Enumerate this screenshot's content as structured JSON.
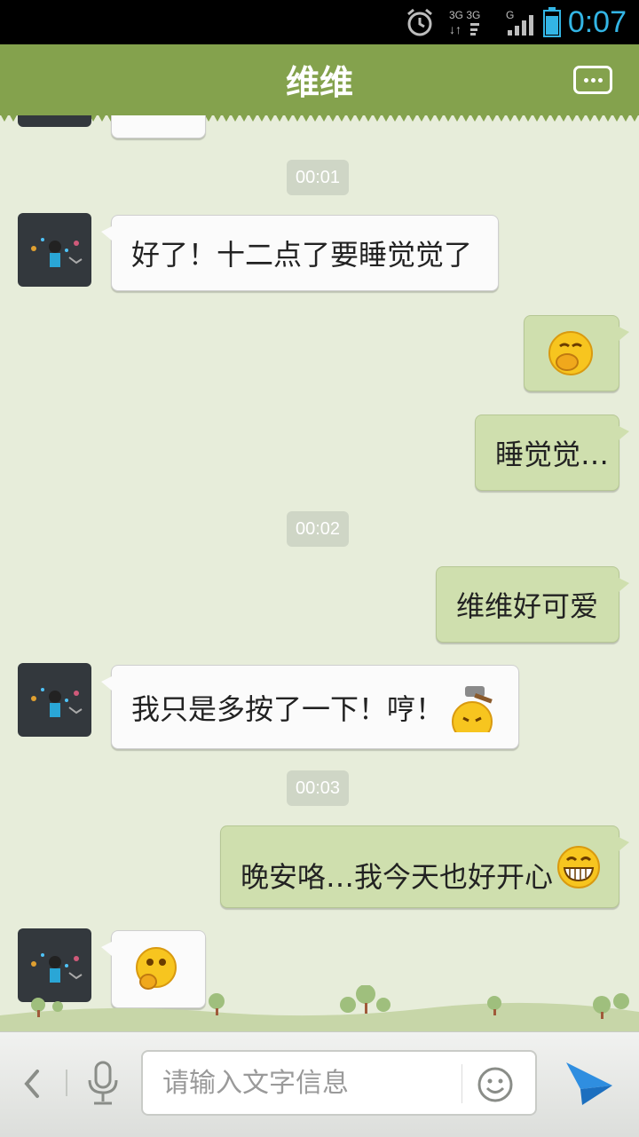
{
  "status_bar": {
    "time": "0:07"
  },
  "header": {
    "title": "维维"
  },
  "messages": [
    {
      "type": "timestamp",
      "text": "00:01"
    },
    {
      "type": "incoming",
      "text": "好了！十二点了要睡觉觉了"
    },
    {
      "type": "outgoing",
      "emoji": "yawn-emoji"
    },
    {
      "type": "outgoing",
      "text": "睡觉觉…"
    },
    {
      "type": "timestamp",
      "text": "00:02"
    },
    {
      "type": "outgoing",
      "text": "维维好可爱"
    },
    {
      "type": "incoming",
      "text": "我只是多按了一下！哼！",
      "emoji": "hammer-emoji"
    },
    {
      "type": "timestamp",
      "text": "00:03"
    },
    {
      "type": "outgoing",
      "text": "晚安咯…我今天也好开心",
      "emoji": "grin-emoji"
    },
    {
      "type": "incoming",
      "emoji": "thinking-emoji"
    }
  ],
  "input_bar": {
    "placeholder": "请输入文字信息"
  },
  "colors": {
    "header": "#84a24d",
    "background": "#e7edda",
    "outgoing_bubble": "#cfdfae",
    "incoming_bubble": "#fbfbfb",
    "time": "#33b5e5"
  }
}
